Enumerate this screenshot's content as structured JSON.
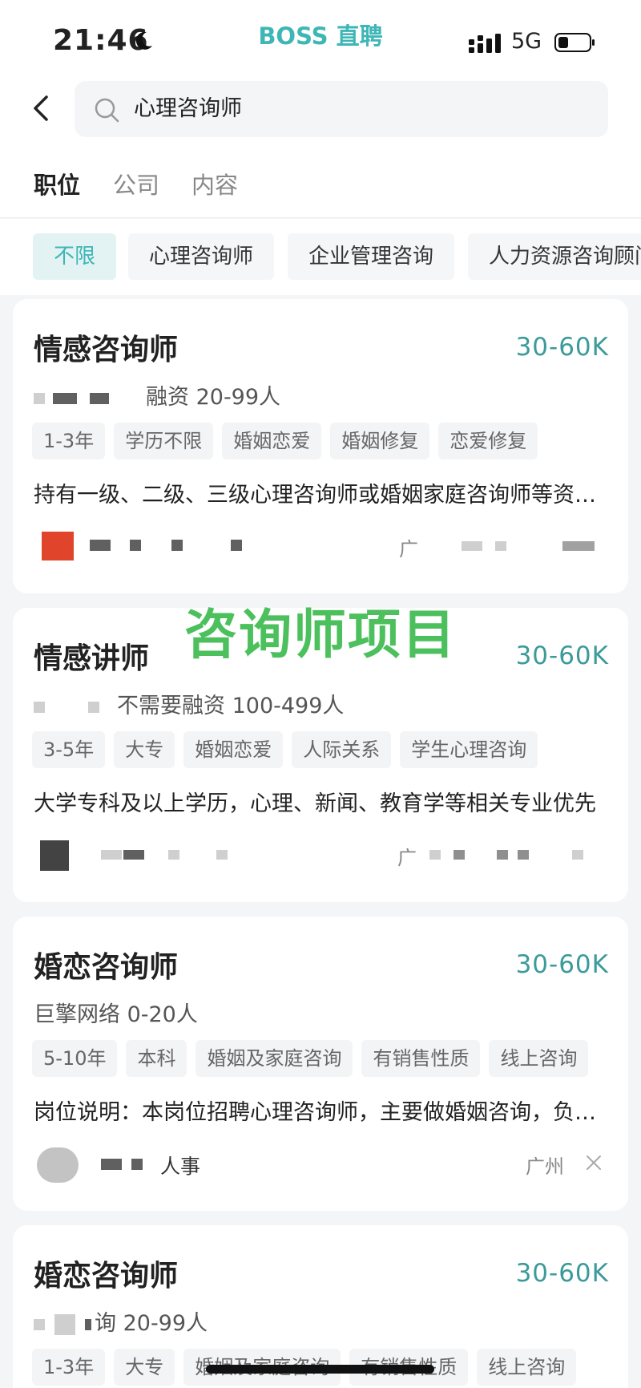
{
  "status": {
    "time": "21:46",
    "network": "5G"
  },
  "brand": "BOSS 直聘",
  "search": {
    "query": "心理咨询师"
  },
  "tabs": [
    {
      "label": "职位",
      "active": true
    },
    {
      "label": "公司",
      "active": false
    },
    {
      "label": "内容",
      "active": false
    }
  ],
  "filters": [
    {
      "label": "不限",
      "active": true
    },
    {
      "label": "心理咨询师",
      "active": false
    },
    {
      "label": "企业管理咨询",
      "active": false
    },
    {
      "label": "人力资源咨询顾问",
      "active": false
    }
  ],
  "watermark": "咨询师项目",
  "jobs": [
    {
      "title": "情感咨询师",
      "salary": "30-60K",
      "company": "融资 20-99人",
      "tags": [
        "1-3年",
        "学历不限",
        "婚姻恋爱",
        "婚姻修复",
        "恋爱修复"
      ],
      "description": "持有一级、二级、三级心理咨询师或婚姻家庭咨询师等资格证书",
      "recruiter": "",
      "location": "广"
    },
    {
      "title": "情感讲师",
      "salary": "30-60K",
      "company": "不需要融资 100-499人",
      "tags": [
        "3-5年",
        "大专",
        "婚姻恋爱",
        "人际关系",
        "学生心理咨询"
      ],
      "description": "大学专科及以上学历，心理、新闻、教育学等相关专业优先",
      "recruiter": "",
      "location": "广"
    },
    {
      "title": "婚恋咨询师",
      "salary": "30-60K",
      "company": "巨擎网络 0-20人",
      "tags": [
        "5-10年",
        "本科",
        "婚姻及家庭咨询",
        "有销售性质",
        "线上咨询"
      ],
      "description": "岗位说明：本岗位招聘心理咨询师，主要做婚姻咨询，负责客户",
      "recruiter": "人事",
      "location": "广州"
    },
    {
      "title": "婚恋咨询师",
      "salary": "30-60K",
      "company": "询 20-99人",
      "tags": [
        "1-3年",
        "大专",
        "婚姻及家庭咨询",
        "有销售性质",
        "线上咨询"
      ],
      "description": "",
      "recruiter": "",
      "location": ""
    }
  ],
  "colors": {
    "accent": "#3fb6b6",
    "salary": "#3d9a9a",
    "watermark": "#3dbb4f"
  }
}
